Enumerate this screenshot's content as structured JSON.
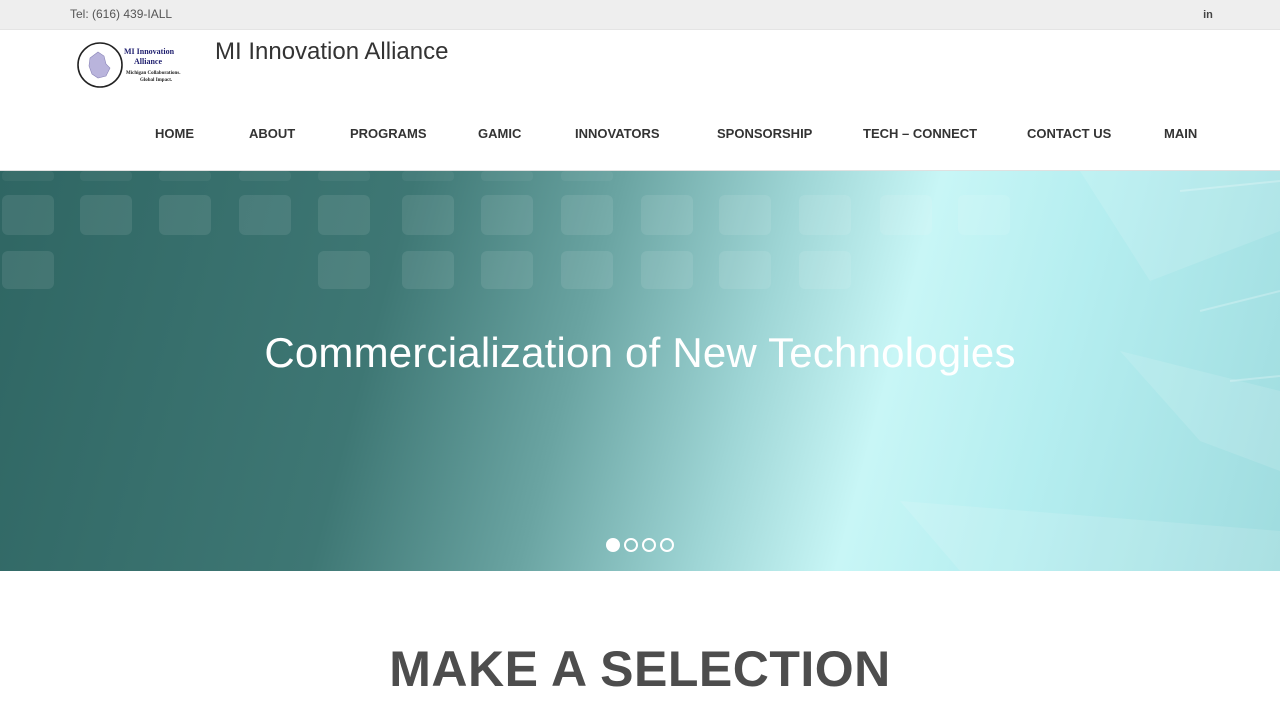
{
  "topbar": {
    "tel": "Tel: (616) 439-IALL",
    "social_icon": "linkedin-icon",
    "social_glyph": "in"
  },
  "header": {
    "logo_lines": [
      "MI Innovation",
      "Alliance",
      "Michigan Collaborations.",
      "Global Impact."
    ],
    "site_title": "MI Innovation Alliance"
  },
  "nav": {
    "items": [
      "HOME",
      "ABOUT",
      "PROGRAMS",
      "GAMIC",
      "INNOVATORS",
      "SPONSORSHIP",
      "TECH – CONNECT",
      "CONTACT US",
      "MAIN"
    ]
  },
  "hero": {
    "title": "Commercialization of New Technologies",
    "slides": 4,
    "active_slide": 1
  },
  "main": {
    "section_title": "MAKE A SELECTION"
  },
  "colors": {
    "topbar_bg": "#eeeeee",
    "nav_text": "#333333",
    "hero_dark": "#2f6663",
    "hero_light": "#c8f6f6",
    "section_title": "#4d4d4d"
  }
}
